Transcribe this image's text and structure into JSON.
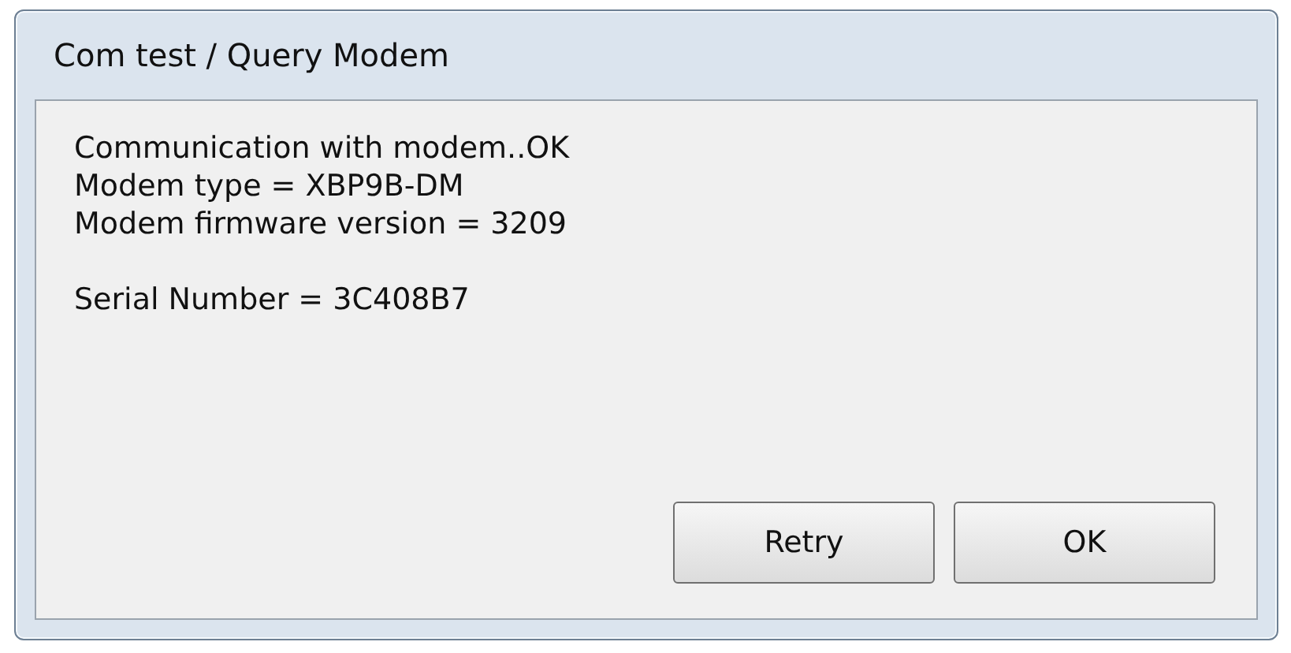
{
  "window": {
    "title": "Com test / Query Modem"
  },
  "paragraphs": [
    {
      "lines": [
        "Communication with modem..OK",
        "Modem type = XBP9B-DM",
        "Modem firmware version = 3209"
      ]
    },
    {
      "lines": [
        "Serial Number = 3C408B7"
      ]
    }
  ],
  "buttons": [
    "Retry",
    "OK"
  ]
}
